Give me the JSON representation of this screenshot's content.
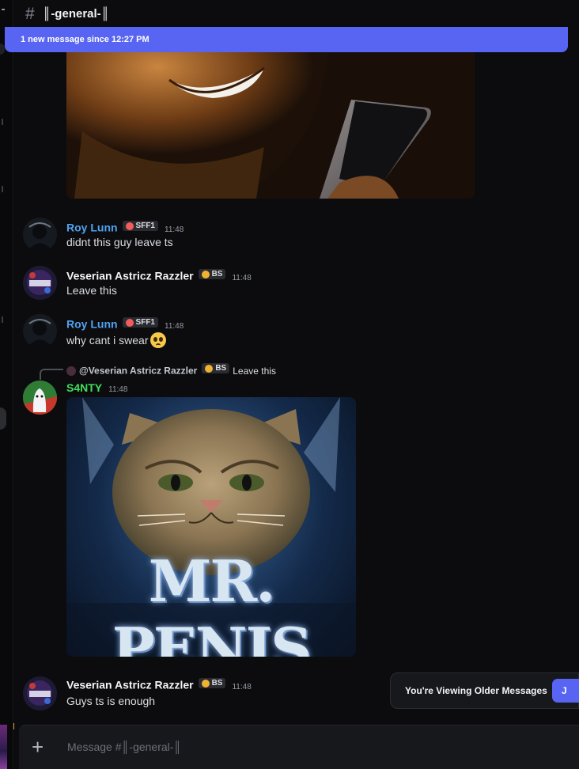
{
  "channel": {
    "icon": "hash-icon",
    "name": "║-general-║"
  },
  "new_messages_bar": {
    "text": "1 new message since 12:27 PM"
  },
  "messages": [
    {
      "username": "Roy Lunn",
      "name_color": "#4ea3f1",
      "badge": "SFF1",
      "time": "11:48",
      "text": "didnt this guy leave ts"
    },
    {
      "username": "Veserian Astricz Razzler",
      "name_color": "#f2f3f5",
      "badge": "BS",
      "time": "11:48",
      "text": "Leave this"
    },
    {
      "username": "Roy Lunn",
      "name_color": "#4ea3f1",
      "badge": "SFF1",
      "time": "11:48",
      "text": "why cant i swear",
      "emoji": "pleading-face"
    },
    {
      "username": "S4NTY",
      "name_color": "#3ee15a",
      "time": "11:48",
      "reply": {
        "username": "@Veserian Astricz Razzler",
        "badge": "BS",
        "text": "Leave this"
      },
      "image_caption": "MR. PENIS"
    },
    {
      "username": "Veserian Astricz Razzler",
      "name_color": "#f2f3f5",
      "badge": "BS",
      "time": "11:48",
      "text": "Guys ts is enough"
    }
  ],
  "older_messages": {
    "text": "You're Viewing Older Messages",
    "jump_label": "J"
  },
  "composer": {
    "placeholder": "Message #║-general-║",
    "add_icon": "plus-icon"
  },
  "colors": {
    "accent": "#5865f2",
    "background": "#0c0c0f",
    "badge_bg": "#2a2b30"
  }
}
